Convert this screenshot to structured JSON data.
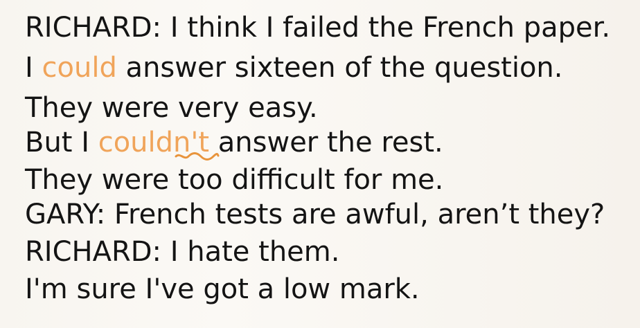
{
  "lines": [
    {
      "parts": [
        "RICHARD: I think I failed the French paper."
      ]
    },
    {
      "parts": [
        "I ",
        "could",
        " answer sixteen of the question."
      ],
      "highlighted": [
        1
      ]
    },
    {
      "parts": [
        "They were very easy."
      ]
    },
    {
      "parts": [
        "But I ",
        "couldn't",
        " answer the rest."
      ],
      "highlighted": [
        1
      ]
    },
    {
      "parts": [
        "They were too difficult for me."
      ]
    },
    {
      "parts": [
        "GARY: French tests are awful, aren’t they?"
      ]
    },
    {
      "parts": [
        "RICHARD: I hate them."
      ]
    },
    {
      "parts": [
        "I'm sure I've got a low mark."
      ]
    }
  ],
  "colors": {
    "text": "#141414",
    "highlight": "#f0a45a",
    "annotation": "#e8943c"
  },
  "annotation": {
    "type": "squiggle-underline",
    "target": "n't"
  }
}
